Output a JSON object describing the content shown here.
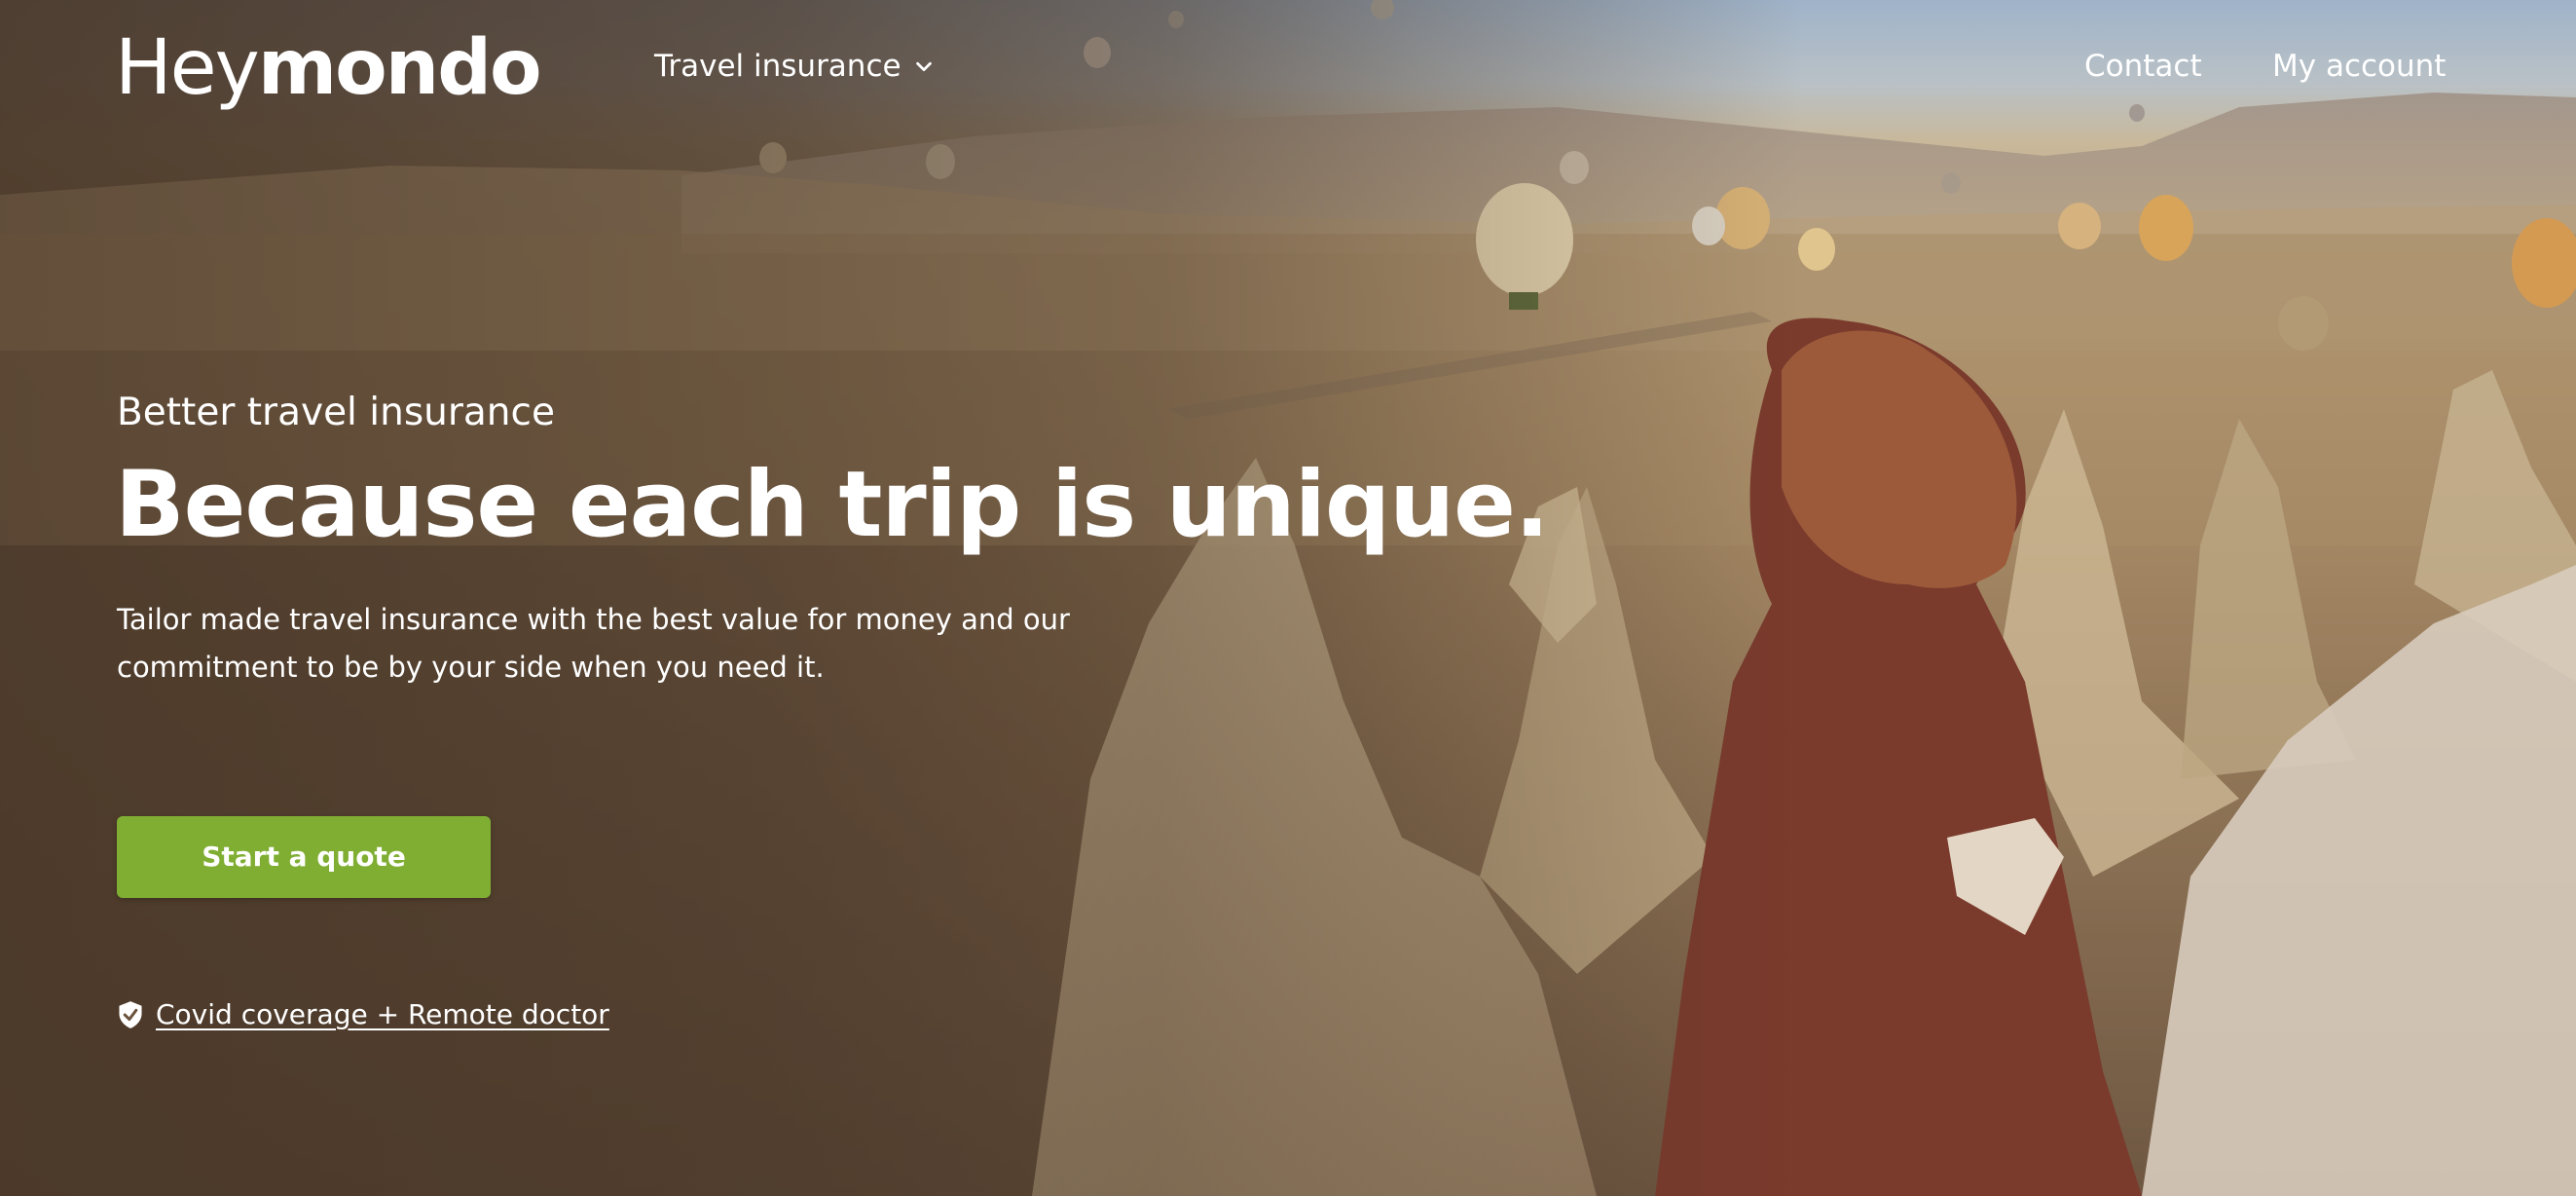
{
  "brand": {
    "logo_hey": "Hey",
    "logo_mondo": "mondo"
  },
  "nav": {
    "travel_insurance": "Travel insurance",
    "contact": "Contact",
    "my_account": "My account",
    "travel_icon": "chevron-down-icon"
  },
  "hero": {
    "subtitle": "Better travel insurance",
    "headline": "Because each trip is unique.",
    "description": "Tailor made travel insurance with the best value for money and our commitment to be by your side when you need it.",
    "cta": "Start a quote",
    "covid_link": "Covid coverage + Remote doctor",
    "covid_icon": "shield-check-icon"
  },
  "colors": {
    "cta_bg": "#7fae33",
    "text": "#ffffff"
  }
}
